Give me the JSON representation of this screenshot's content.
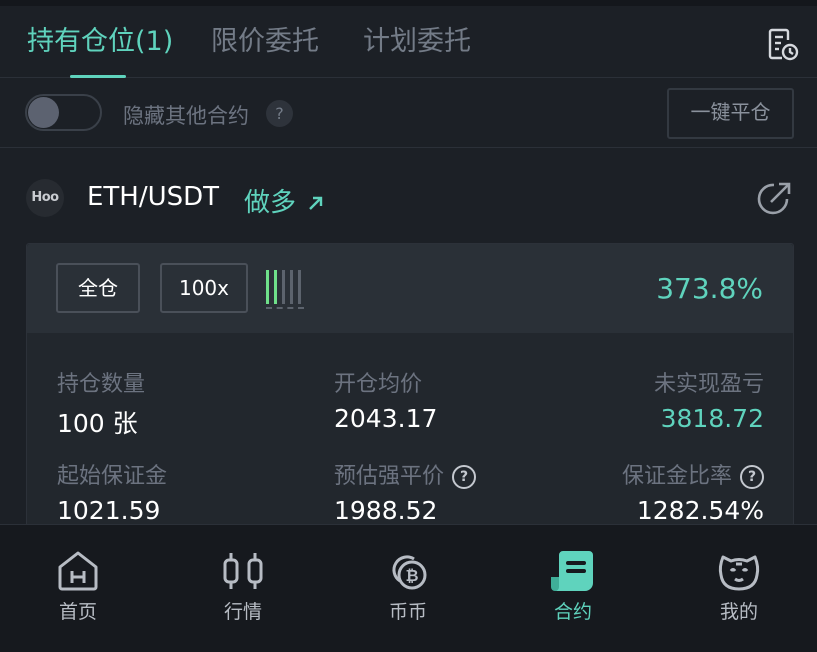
{
  "tabs": [
    {
      "label": "持有仓位(1)",
      "active": true
    },
    {
      "label": "限价委托",
      "active": false
    },
    {
      "label": "计划委托",
      "active": false
    }
  ],
  "filter": {
    "toggle_on": false,
    "hide_label": "隐藏其他合约",
    "help_glyph": "?",
    "close_all_label": "一键平仓"
  },
  "position": {
    "logo_text": "Hoo",
    "pair": "ETH/USDT",
    "side": "做多",
    "margin_mode": "全仓",
    "leverage": "100x",
    "adl_level": 1,
    "adl_max": 5,
    "roe": "373.8%",
    "stats": {
      "qty_label": "持仓数量",
      "qty_value": "100 张",
      "entry_label": "开仓均价",
      "entry_value": "2043.17",
      "pnl_label": "未实现盈亏",
      "pnl_value": "3818.72",
      "init_margin_label": "起始保证金",
      "init_margin_value": "1021.59",
      "liq_label": "预估强平价",
      "liq_value": "1988.52",
      "ratio_label": "保证金比率",
      "ratio_value": "1282.54%",
      "help_glyph": "?"
    }
  },
  "nav": [
    {
      "label": "首页",
      "icon": "home-icon",
      "active": false
    },
    {
      "label": "行情",
      "icon": "candlestick-icon",
      "active": false
    },
    {
      "label": "币币",
      "icon": "coin-icon",
      "active": false
    },
    {
      "label": "合约",
      "icon": "contract-icon",
      "active": true
    },
    {
      "label": "我的",
      "icon": "mascot-icon",
      "active": false
    }
  ],
  "colors": {
    "accent": "#5fd3bd",
    "background": "#1c2026",
    "adl_on": "#6fe08a"
  }
}
